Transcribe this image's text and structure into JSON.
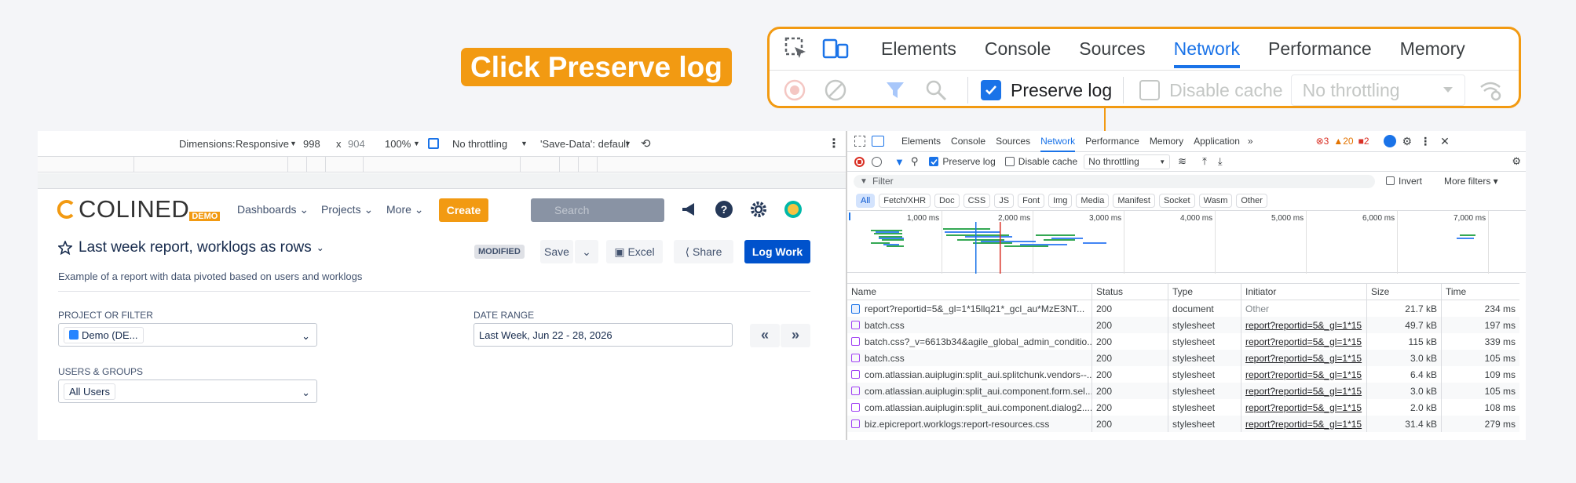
{
  "callout": {
    "label": "Click Preserve log"
  },
  "zoom": {
    "tabs": [
      "Elements",
      "Console",
      "Sources",
      "Network",
      "Performance",
      "Memory"
    ],
    "active_tab": "Network",
    "preserve_log": "Preserve log",
    "disable_cache": "Disable cache",
    "throttling": "No throttling"
  },
  "device_toolbar": {
    "dimensions_label": "Dimensions:",
    "dimensions_value": "Responsive",
    "width": "998",
    "times": "x",
    "height": "904",
    "zoom": "100%",
    "throttling": "No throttling",
    "save_data": "'Save-Data': default"
  },
  "app": {
    "logo": "COLINED",
    "logo_badge": "DEMO",
    "nav": [
      "Dashboards",
      "Projects",
      "More"
    ],
    "create": "Create",
    "search_placeholder": "Search",
    "title": "Last week report, worklogs as rows",
    "subtitle": "Example of a report with data pivoted based on users and worklogs",
    "badge": "MODIFIED",
    "save": "Save",
    "excel": "Excel",
    "share": "Share",
    "log_work": "Log Work",
    "project_label": "PROJECT OR FILTER",
    "project_value": "Demo (DE...",
    "date_label": "DATE RANGE",
    "date_value": "Last Week, Jun 22 - 28, 2026",
    "prev": "«",
    "next": "»",
    "users_label": "USERS & GROUPS",
    "users_value": "All Users"
  },
  "devtools": {
    "tabs": [
      "Elements",
      "Console",
      "Sources",
      "Network",
      "Performance",
      "Memory",
      "Application"
    ],
    "active_tab": "Network",
    "errors": "3",
    "warnings": "20",
    "issues": "2",
    "preserve_log": "Preserve log",
    "disable_cache": "Disable cache",
    "throttling": "No throttling",
    "filter_placeholder": "Filter",
    "invert": "Invert",
    "more_filters": "More filters",
    "types": [
      "All",
      "Fetch/XHR",
      "Doc",
      "CSS",
      "JS",
      "Font",
      "Img",
      "Media",
      "Manifest",
      "Socket",
      "Wasm",
      "Other"
    ],
    "timeline_ticks": [
      "1,000 ms",
      "2,000 ms",
      "3,000 ms",
      "4,000 ms",
      "5,000 ms",
      "6,000 ms",
      "7,000 ms"
    ],
    "columns": [
      "Name",
      "Status",
      "Type",
      "Initiator",
      "Size",
      "Time"
    ],
    "rows": [
      {
        "name": "report?reportid=5&_gl=1*15llq21*_gcl_au*MzE3NT...",
        "status": "200",
        "type": "document",
        "initiator": "Other",
        "size": "21.7 kB",
        "time": "234 ms",
        "kind": "doc"
      },
      {
        "name": "batch.css",
        "status": "200",
        "type": "stylesheet",
        "initiator": "report?reportid=5&_gl=1*15",
        "size": "49.7 kB",
        "time": "197 ms",
        "kind": "css"
      },
      {
        "name": "batch.css?_v=6613b34&agile_global_admin_conditio...",
        "status": "200",
        "type": "stylesheet",
        "initiator": "report?reportid=5&_gl=1*15",
        "size": "115 kB",
        "time": "339 ms",
        "kind": "css"
      },
      {
        "name": "batch.css",
        "status": "200",
        "type": "stylesheet",
        "initiator": "report?reportid=5&_gl=1*15",
        "size": "3.0 kB",
        "time": "105 ms",
        "kind": "css"
      },
      {
        "name": "com.atlassian.auiplugin:split_aui.splitchunk.vendors--...",
        "status": "200",
        "type": "stylesheet",
        "initiator": "report?reportid=5&_gl=1*15",
        "size": "6.4 kB",
        "time": "109 ms",
        "kind": "css"
      },
      {
        "name": "com.atlassian.auiplugin:split_aui.component.form.sel...",
        "status": "200",
        "type": "stylesheet",
        "initiator": "report?reportid=5&_gl=1*15",
        "size": "3.0 kB",
        "time": "105 ms",
        "kind": "css"
      },
      {
        "name": "com.atlassian.auiplugin:split_aui.component.dialog2....",
        "status": "200",
        "type": "stylesheet",
        "initiator": "report?reportid=5&_gl=1*15",
        "size": "2.0 kB",
        "time": "108 ms",
        "kind": "css"
      },
      {
        "name": "biz.epicreport.worklogs:report-resources.css",
        "status": "200",
        "type": "stylesheet",
        "initiator": "report?reportid=5&_gl=1*15",
        "size": "31.4 kB",
        "time": "279 ms",
        "kind": "css"
      }
    ]
  },
  "colors": {
    "accent": "#f29a12",
    "devtools_blue": "#1a73e8",
    "jira_blue": "#0052cc"
  }
}
